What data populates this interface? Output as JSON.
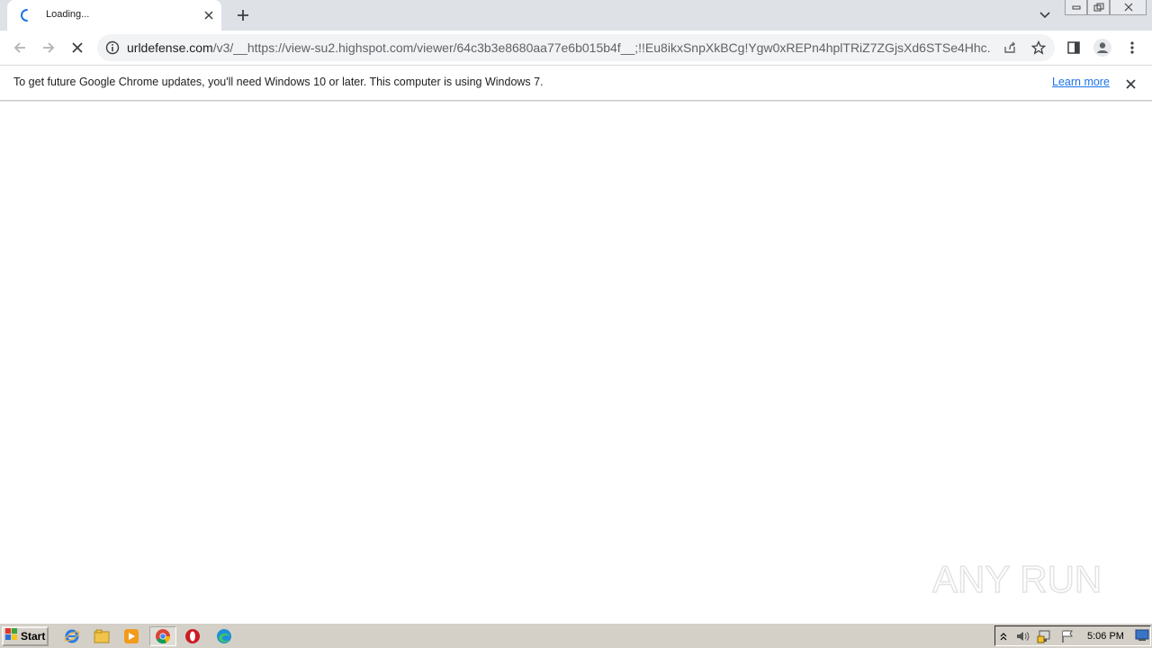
{
  "tab": {
    "title": "Loading..."
  },
  "address_bar": {
    "host": "urldefense.com",
    "path": "/v3/__https://view-su2.highspot.com/viewer/64c3b3e8680aa77e6b015b4f__;!!Eu8ikxSnpXkBCg!Ygw0xREPn4hplTRiZ7ZGjsXd6STSe4Hhc..."
  },
  "infobar": {
    "message": "To get future Google Chrome updates, you'll need Windows 10 or later. This computer is using Windows 7.",
    "link_label": "Learn more"
  },
  "taskbar": {
    "start_label": "Start",
    "clock": "5:06 PM",
    "apps": [
      "internet-explorer-icon",
      "file-explorer-icon",
      "media-player-icon",
      "chrome-icon",
      "opera-icon",
      "edge-icon"
    ]
  },
  "watermark": {
    "text": "ANY RUN"
  },
  "colors": {
    "tabstrip": "#dee1e6",
    "omnibox": "#f1f3f4",
    "link": "#1a73e8",
    "taskbar": "#d4d0c8"
  }
}
